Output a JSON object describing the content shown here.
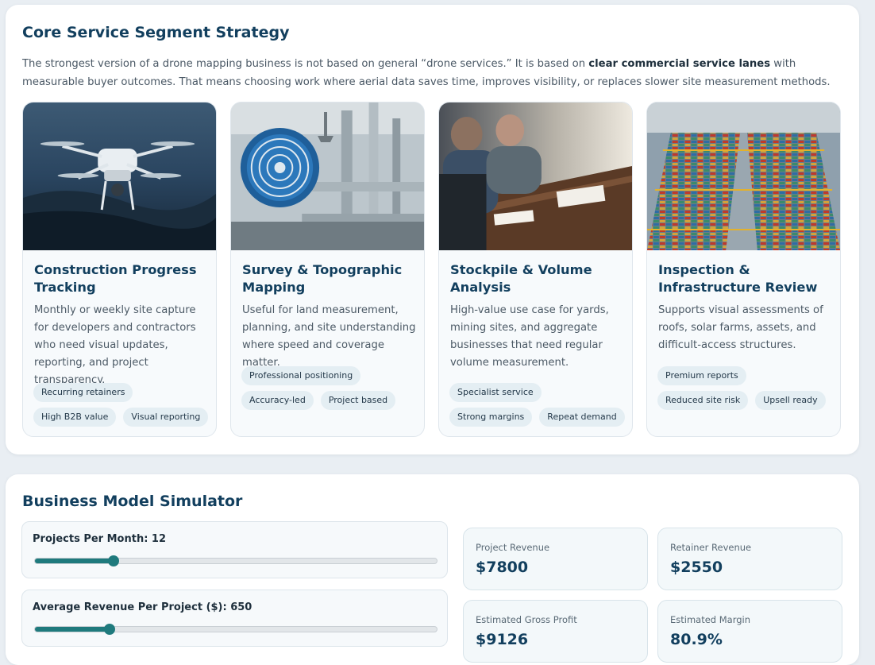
{
  "strategy": {
    "title": "Core Service Segment Strategy",
    "intro_before": "The strongest version of a drone mapping business is not based on general “drone services.” It is based on ",
    "intro_bold": "clear commercial service lanes",
    "intro_after": " with measurable buyer outcomes. That means choosing work where aerial data saves time, improves visibility, or replaces slower site measurement methods.",
    "cards": [
      {
        "title": "Construction Progress Tracking",
        "description": "Monthly or weekly site capture for developers and contractors who need visual updates, reporting, and project transparency.",
        "image": "drone-photo",
        "tags": [
          "Recurring retainers",
          "High B2B value",
          "Visual reporting"
        ]
      },
      {
        "title": "Survey & Topographic Mapping",
        "description": "Useful for land measurement, planning, and site understanding where speed and coverage matter.",
        "image": "industrial-pipes-photo",
        "tags": [
          "Professional positioning",
          "Accuracy-led",
          "Project based"
        ]
      },
      {
        "title": "Stockpile & Volume Analysis",
        "description": "High-value use case for yards, mining sites, and aggregate businesses that need regular volume measurement.",
        "image": "meeting-table-photo",
        "tags": [
          "Specialist service",
          "Strong margins",
          "Repeat demand"
        ]
      },
      {
        "title": "Inspection & Infrastructure Review",
        "description": "Supports visual assessments of roofs, solar farms, assets, and difficult-access structures.",
        "image": "container-port-photo",
        "tags": [
          "Premium reports",
          "Reduced site risk",
          "Upsell ready"
        ]
      }
    ]
  },
  "simulator": {
    "title": "Business Model Simulator",
    "sliders": [
      {
        "label": "Projects Per Month: 12",
        "fill_fraction": 0.195
      },
      {
        "label": "Average Revenue Per Project ($): 650",
        "fill_fraction": 0.185
      }
    ],
    "stats": {
      "project_revenue": {
        "label": "Project Revenue",
        "value": "$7800"
      },
      "retainer_revenue": {
        "label": "Retainer Revenue",
        "value": "$2550"
      },
      "gross_profit": {
        "label": "Estimated Gross Profit",
        "value": "$9126"
      },
      "margin": {
        "label": "Estimated Margin",
        "value": "80.9%"
      }
    }
  },
  "colors": {
    "heading": "#123f5e",
    "accent_teal": "#1f7a7d",
    "tag_bg": "#e4eef3",
    "card_bg": "#f7fafc",
    "page_bg": "#e9eef3"
  }
}
